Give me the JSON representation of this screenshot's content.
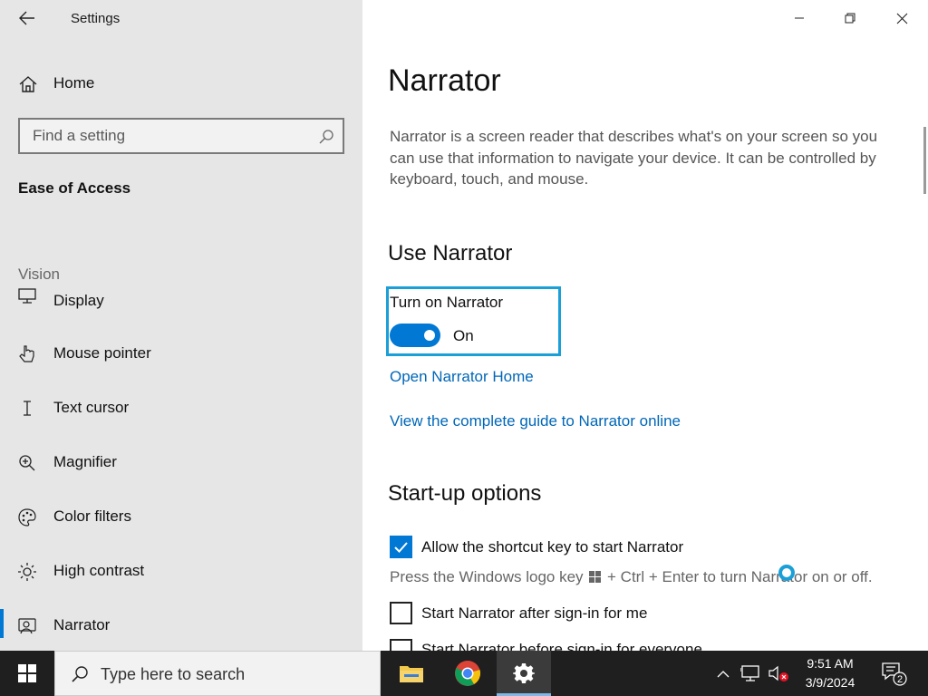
{
  "window": {
    "title": "Settings"
  },
  "sidebar": {
    "home_label": "Home",
    "search_placeholder": "Find a setting",
    "category": "Ease of Access",
    "section": "Vision",
    "items": [
      {
        "label": "Display",
        "icon": "monitor-icon"
      },
      {
        "label": "Mouse pointer",
        "icon": "mouse-pointer-icon"
      },
      {
        "label": "Text cursor",
        "icon": "text-cursor-icon"
      },
      {
        "label": "Magnifier",
        "icon": "magnifier-icon"
      },
      {
        "label": "Color filters",
        "icon": "palette-icon"
      },
      {
        "label": "High contrast",
        "icon": "sun-icon"
      },
      {
        "label": "Narrator",
        "icon": "narrator-icon",
        "active": true
      }
    ]
  },
  "main": {
    "title": "Narrator",
    "description": "Narrator is a screen reader that describes what's on your screen so you can use that information to navigate your device. It can be controlled by keyboard, touch, and mouse.",
    "use_heading": "Use Narrator",
    "toggle_label": "Turn on Narrator",
    "toggle_state": "On",
    "toggle_on": true,
    "link_home": "Open Narrator Home",
    "link_guide": "View the complete guide to Narrator online",
    "startup_heading": "Start-up options",
    "shortcut_label": "Allow the shortcut key to start Narrator",
    "shortcut_checked": true,
    "hint_before": "Press the Windows logo key",
    "hint_after": "+ Ctrl + Enter to turn Narrator on or off.",
    "after_signin_label": "Start Narrator after sign-in for me",
    "after_signin_checked": false,
    "before_signin_label": "Start Narrator before sign-in for everyone",
    "before_signin_checked": false
  },
  "taskbar": {
    "search_placeholder": "Type here to search",
    "time": "9:51 AM",
    "date": "3/9/2024",
    "notification_count": "2"
  },
  "colors": {
    "accent": "#0078d4",
    "link": "#0067b8",
    "focus": "#1a9fd6",
    "sidebar_bg": "#e6e6e6",
    "taskbar_bg": "#1f1f1f"
  }
}
